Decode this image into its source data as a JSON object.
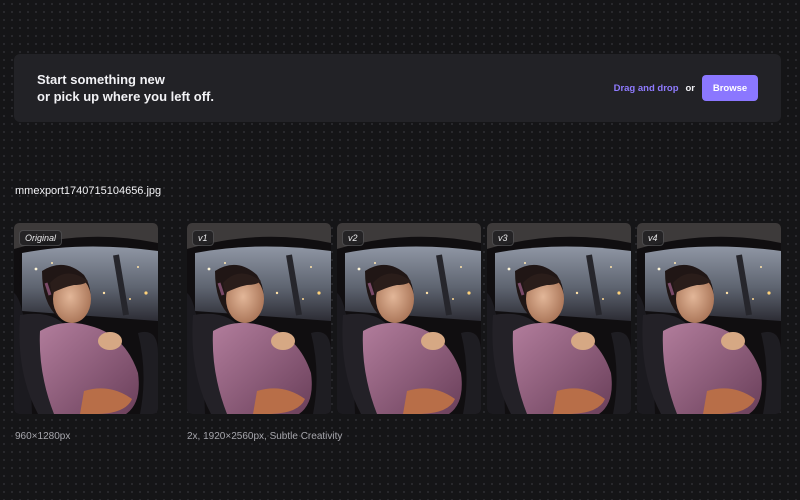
{
  "banner": {
    "line1": "Start something new",
    "line2": "or pick up where you left off.",
    "drag_label": "Drag and drop",
    "or_label": "or",
    "browse_label": "Browse"
  },
  "file": {
    "name": "mmexport1740715104656.jpg"
  },
  "thumbnails": [
    {
      "label": "Original"
    },
    {
      "label": "v1"
    },
    {
      "label": "v2"
    },
    {
      "label": "v3"
    },
    {
      "label": "v4"
    }
  ],
  "captions": {
    "original": "960×1280px",
    "versions": "2x, 1920×2560px, Subtle Creativity"
  },
  "colors": {
    "accent": "#8b77ff",
    "accent_link": "#8f7bff",
    "panel": "#222226",
    "background": "#151517"
  }
}
